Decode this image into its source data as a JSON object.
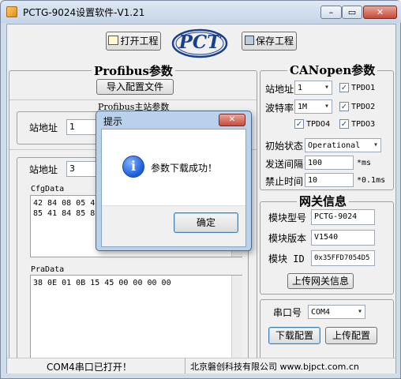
{
  "window": {
    "title": "PCTG-9024设置软件-V1.21",
    "min": "–",
    "max": "▭",
    "close": "✕"
  },
  "toolbar": {
    "open_label": "打开工程",
    "save_label": "保存工程",
    "logo_text": "PCT"
  },
  "profibus": {
    "title": "Profibus参数",
    "import_label": "导入配置文件",
    "master_title": "Profibus主站参数",
    "station_label": "站地址",
    "station_value": "1",
    "slave_title": "",
    "station2_label": "站地址",
    "station2_value": "3",
    "cfg_label": "CfgData",
    "cfg_value": "42 84 08 05 42\n85 41 84 85 82",
    "pra_label": "PraData",
    "pra_value": "38 0E 01 0B 15 45 00 00 00 00"
  },
  "canopen": {
    "title": "CANopen参数",
    "station_label": "站地址",
    "station_value": "1",
    "baud_label": "波特率",
    "baud_value": "1M",
    "tpdo1": "TPDO1",
    "tpdo2": "TPDO2",
    "tpdo3": "TPDO3",
    "tpdo4": "TPDO4",
    "check": "✓",
    "init_label": "初始状态",
    "init_value": "Operational",
    "send_label": "发送间隔",
    "send_value": "100",
    "send_unit": "*ms",
    "inhibit_label": "禁止时间",
    "inhibit_value": "10",
    "inhibit_unit": "*0.1ms"
  },
  "gateway": {
    "title": "网关信息",
    "model_label": "模块型号",
    "model_value": "PCTG-9024",
    "version_label": "模块版本",
    "version_value": "V1540",
    "id_label": "模块 ID",
    "id_value": "0x35FFD7054D5",
    "upload_label": "上传网关信息"
  },
  "serial": {
    "port_label": "串口号",
    "port_value": "COM4",
    "download_label": "下载配置",
    "upload_label": "上传配置"
  },
  "dialog": {
    "title": "提示",
    "close": "✕",
    "icon": "i",
    "message": "参数下载成功！",
    "ok_label": "确定"
  },
  "status": {
    "left": "COM4串口已打开！",
    "right": "北京磐创科技有限公司 www.bjpct.com.cn"
  }
}
